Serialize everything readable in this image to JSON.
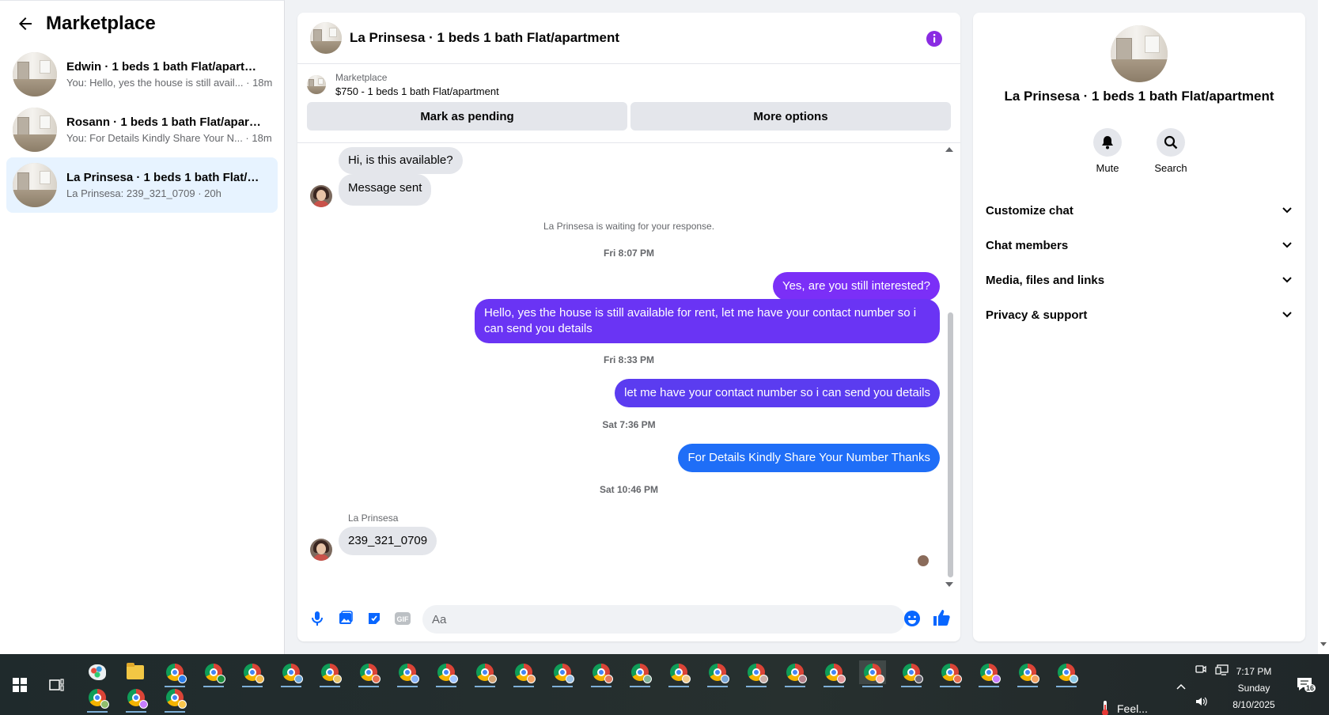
{
  "sidebar": {
    "title": "Marketplace",
    "conversations": [
      {
        "name": "Edwin · 1 beds 1 bath Flat/apartment",
        "preview": "You: Hello, yes the house is still avail... · 18m"
      },
      {
        "name": "Rosann · 1 beds 1 bath Flat/apartm...",
        "preview": "You: For Details Kindly Share Your N... · 18m"
      },
      {
        "name": "La Prinsesa · 1 beds 1 bath Flat/apa...",
        "preview": "La Prinsesa: 239_321_0709 · 20h"
      }
    ]
  },
  "chat": {
    "title": "La Prinsesa · 1 beds 1 bath Flat/apartment",
    "listing_label": "Marketplace",
    "listing_price": "$750 - 1 beds 1 bath Flat/apartment",
    "btn_pending": "Mark as pending",
    "btn_more": "More options",
    "msg_available": "Hi, is this available?",
    "msg_sent": "Message sent",
    "waiting_note": "La Prinsesa is waiting for your response.",
    "ts1": "Fri 8:07 PM",
    "out1": "Yes, are you still interested?",
    "out2": "Hello, yes the house is still available for rent, let me have your contact number so i can send you details",
    "ts2": "Fri 8:33 PM",
    "out3": "let me have your contact number so i can send you details",
    "ts3": "Sat 7:36 PM",
    "out4": "For  Details Kindly Share Your Number Thanks",
    "ts4": "Sat 10:46 PM",
    "sender": "La Prinsesa",
    "in_number": "239_321_0709",
    "composer_placeholder": "Aa"
  },
  "colors": {
    "accent_purple": "#8a2be2",
    "bubble_purple": "#7b2ff7",
    "bubble_indigo": "#5b3cf0",
    "bubble_blue": "#1f6ef7",
    "messenger_blue": "#0866ff"
  },
  "info": {
    "title": "La Prinsesa · 1 beds 1 bath Flat/apartment",
    "mute": "Mute",
    "search": "Search",
    "sections": [
      "Customize chat",
      "Chat members",
      "Media, files and links",
      "Privacy & support"
    ]
  },
  "taskbar": {
    "weather": "Feel...",
    "time": "7:17 PM",
    "day": "Sunday",
    "date": "8/10/2025",
    "notif_count": "16"
  }
}
